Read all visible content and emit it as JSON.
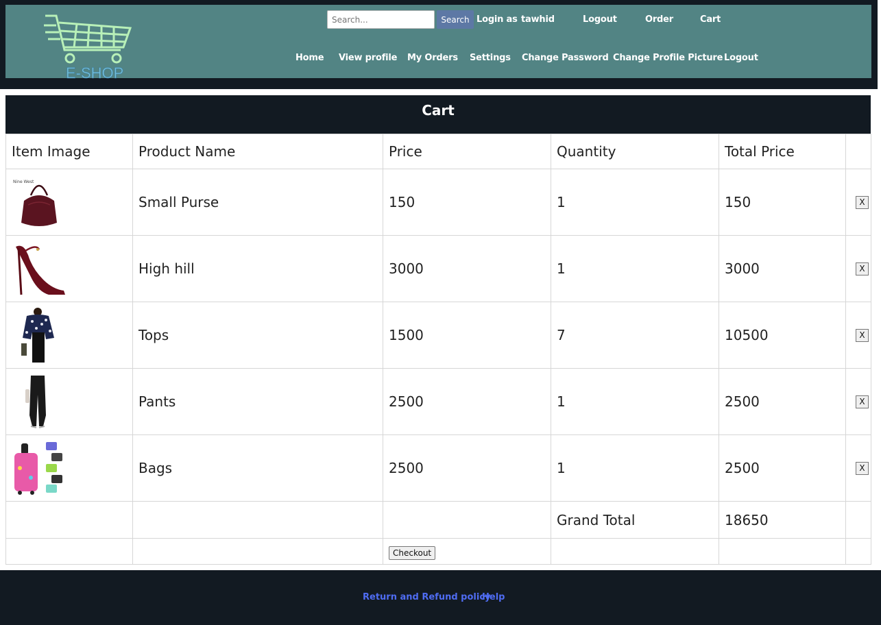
{
  "header": {
    "logo_text": "E-SHOP",
    "search": {
      "placeholder": "Search...",
      "value": "",
      "button_label": "Search"
    },
    "login_prefix": "Login as",
    "username": "tawhid",
    "top_links": {
      "logout": "Logout",
      "order": "Order",
      "cart": "Cart"
    },
    "nav": [
      "Home",
      "View profile",
      "My Orders",
      "Settings",
      "Change Password",
      "Change Profile Picture",
      "Logout"
    ]
  },
  "cart": {
    "title": "Cart",
    "columns": [
      "Item Image",
      "Product Name",
      "Price",
      "Quantity",
      "Total Price"
    ],
    "items": [
      {
        "image": "purse-image",
        "name": "Small Purse",
        "price": "150",
        "quantity": "1",
        "total": "150",
        "remove_label": "X"
      },
      {
        "image": "heels-image",
        "name": "High hill",
        "price": "3000",
        "quantity": "1",
        "total": "3000",
        "remove_label": "X"
      },
      {
        "image": "tops-image",
        "name": "Tops",
        "price": "1500",
        "quantity": "7",
        "total": "10500",
        "remove_label": "X"
      },
      {
        "image": "pants-image",
        "name": "Pants",
        "price": "2500",
        "quantity": "1",
        "total": "2500",
        "remove_label": "X"
      },
      {
        "image": "bags-image",
        "name": "Bags",
        "price": "2500",
        "quantity": "1",
        "total": "2500",
        "remove_label": "X"
      }
    ],
    "grand_total_label": "Grand Total",
    "grand_total_value": "18650",
    "checkout_label": "Checkout"
  },
  "footer": {
    "links": [
      "Return and Refund policy",
      "Help"
    ]
  },
  "colors": {
    "header_bg": "#528484",
    "dark_bg": "#121a22",
    "search_button": "#5d78a5",
    "footer_link": "#4f6cf2"
  }
}
